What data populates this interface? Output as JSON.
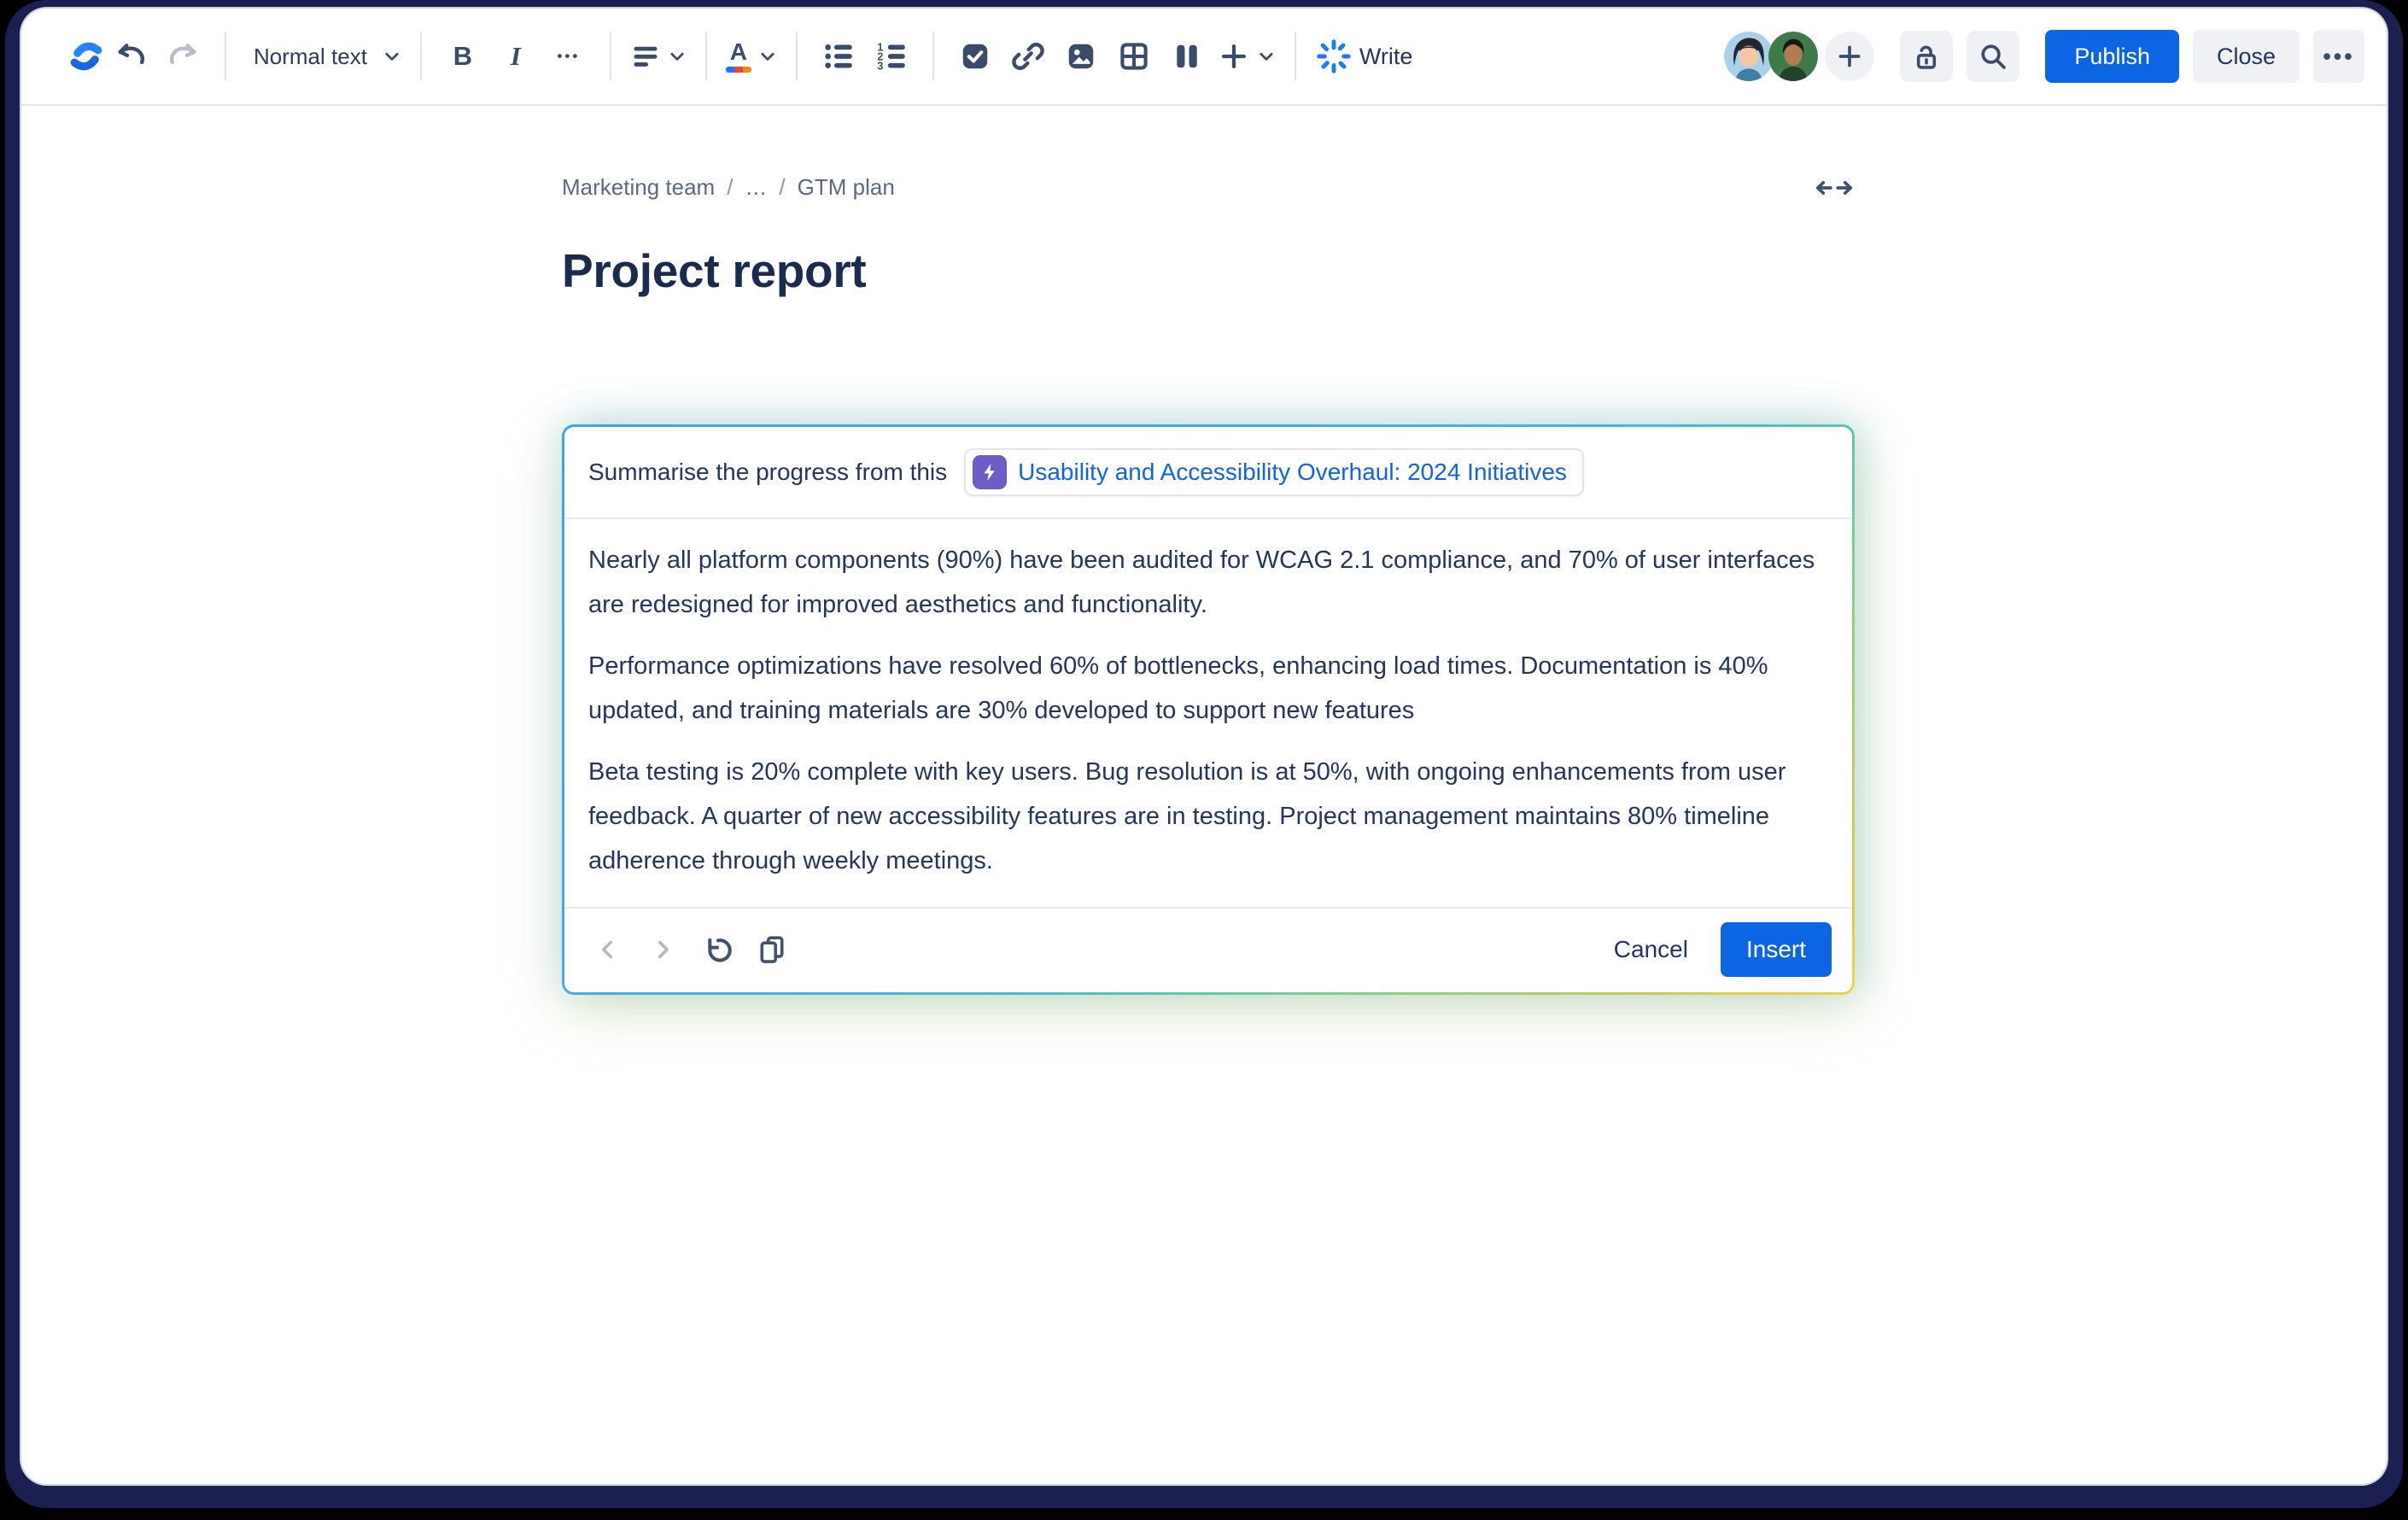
{
  "toolbar": {
    "text_style_label": "Normal text",
    "bold_glyph": "B",
    "italic_glyph": "I",
    "more_glyph": "•••",
    "write_label": "Write",
    "publish_label": "Publish",
    "close_label": "Close",
    "more_actions_glyph": "•••"
  },
  "breadcrumb": {
    "space": "Marketing team",
    "separator": "/",
    "ellipsis": "…",
    "page": "GTM plan"
  },
  "page": {
    "title": "Project report"
  },
  "ai_panel": {
    "prompt_prefix": "Summarise the progress from this",
    "chip_label": "Usability and Accessibility Overhaul: 2024 Initiatives",
    "paragraphs": [
      "Nearly all platform components (90%) have been audited for WCAG 2.1 compliance, and 70% of user interfaces are redesigned for improved aesthetics and functionality.",
      "Performance optimizations have resolved 60% of bottlenecks, enhancing load times. Documentation is 40% updated, and training materials are 30% developed to support new features",
      "Beta testing is 20% complete with key users. Bug resolution is at 50%, with ongoing enhancements from user feedback. A quarter of new accessibility features are in testing. Project management maintains 80% timeline adherence through weekly meetings."
    ],
    "cancel_label": "Cancel",
    "insert_label": "Insert"
  },
  "colors": {
    "accent_blue": "#0C66E4",
    "chip_purple": "#6E5DC6",
    "ai_border_gradient": [
      "#47AAE9",
      "#40BFD0",
      "#8ECF86",
      "#E6C94F"
    ],
    "toolbar_icon": "#44546F",
    "frame_navy": "#1B2050"
  }
}
